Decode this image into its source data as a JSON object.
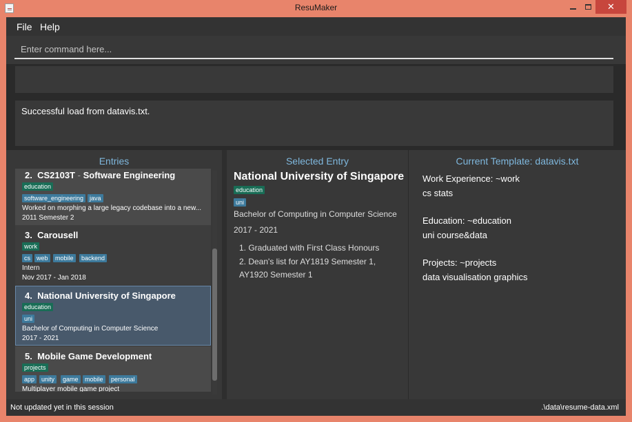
{
  "window": {
    "title": "ResuMaker"
  },
  "menu": {
    "file": "File",
    "help": "Help"
  },
  "command": {
    "placeholder": "Enter command here...",
    "value": ""
  },
  "feedback": {
    "message": "Successful load from datavis.txt."
  },
  "entries": {
    "header": "Entries",
    "items": [
      {
        "index": "2.",
        "title": "CS2103T",
        "separator": "-",
        "subtitle": "Software Engineering",
        "category": "education",
        "tags": [
          "software_engineering",
          "java"
        ],
        "description": "Worked on morphing a large legacy codebase into a new...",
        "duration": "2011 Semester 2"
      },
      {
        "index": "3.",
        "title": "Carousell",
        "category": "work",
        "tags": [
          "cs",
          "web",
          "mobile",
          "backend"
        ],
        "description": "Intern",
        "duration": "Nov 2017 - Jan 2018"
      },
      {
        "index": "4.",
        "title": "National University of Singapore",
        "category": "education",
        "tags": [
          "uni"
        ],
        "description": "Bachelor of Computing in Computer Science",
        "duration": "2017 - 2021"
      },
      {
        "index": "5.",
        "title": "Mobile Game Development",
        "category": "projects",
        "tags": [
          "app",
          "unity",
          "game",
          "mobile",
          "personal"
        ],
        "description": "Multiplayer mobile game project"
      }
    ]
  },
  "selected": {
    "header": "Selected Entry",
    "title": "National University of Singapore",
    "category": "education",
    "tag": "uni",
    "description": "Bachelor of Computing in Computer Science",
    "duration": "2017 - 2021",
    "bullets": [
      "1. Graduated with First Class Honours",
      "2. Dean's list for AY1819 Semester 1,",
      "AY1920 Semester 1"
    ]
  },
  "template": {
    "header": "Current Template: datavis.txt",
    "lines": [
      "Work Experience: ~work",
      "cs stats",
      "Education: ~education",
      "uni course&data",
      "Projects: ~projects",
      "data visualisation graphics"
    ]
  },
  "status": {
    "left": "Not updated yet in this session",
    "right": ".\\data\\resume-data.xml"
  },
  "colors": {
    "accent": "#7fb8de",
    "category_tag": "#196d56",
    "sub_tag": "#3d7a9c",
    "selection": "#48596b"
  }
}
